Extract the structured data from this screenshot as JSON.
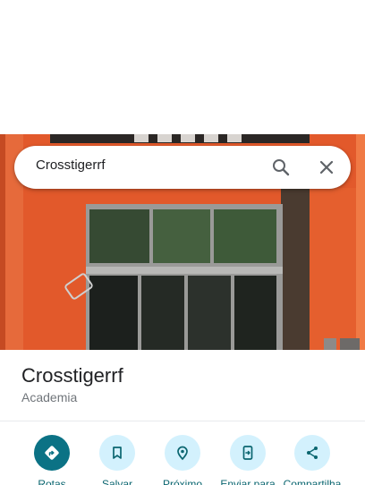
{
  "search": {
    "query": "Crosstigerrf",
    "icons": {
      "search": "search-icon",
      "clear": "close-icon"
    }
  },
  "place": {
    "name": "Crosstigerrf",
    "category": "Academia"
  },
  "actions": [
    {
      "label": "Rotas",
      "icon": "directions-icon"
    },
    {
      "label": "Salvar",
      "icon": "bookmark-icon"
    },
    {
      "label": "Próximo",
      "icon": "nearby-icon"
    },
    {
      "label": "Enviar para",
      "icon": "send-to-phone-icon"
    },
    {
      "label": "Compartilha",
      "icon": "share-icon"
    }
  ],
  "colors": {
    "accent": "#0b7285",
    "action_bg": "#d3f1fd",
    "action_text": "#0b6670",
    "facade": "#e2592b"
  }
}
